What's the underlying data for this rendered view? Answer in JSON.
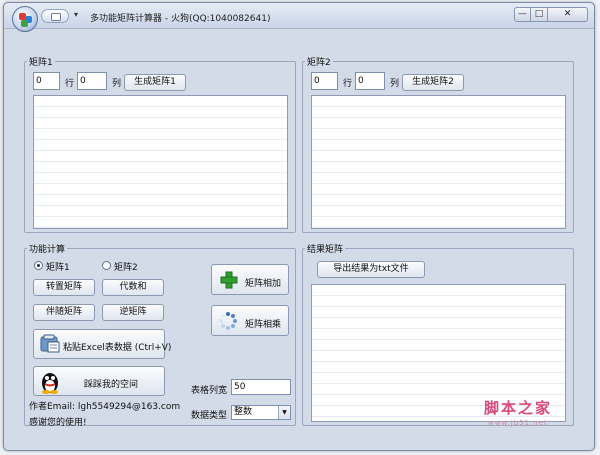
{
  "window": {
    "title": "多功能矩阵计算器 - 火狗(QQ:1040082641)",
    "controls": {
      "minimize": "—",
      "maximize": "□",
      "close": "✕"
    }
  },
  "matrix1": {
    "group_label": "矩阵1",
    "rows_value": "0",
    "rows_label": "行",
    "cols_value": "0",
    "cols_label": "列",
    "generate_label": "生成矩阵1"
  },
  "matrix2": {
    "group_label": "矩阵2",
    "rows_value": "0",
    "rows_label": "行",
    "cols_value": "0",
    "cols_label": "列",
    "generate_label": "生成矩阵2"
  },
  "functions": {
    "group_label": "功能计算",
    "radio1_label": "矩阵1",
    "radio2_label": "矩阵2",
    "selected": "矩阵1",
    "transpose_label": "转置矩阵",
    "cofactor_label": "代数和",
    "adjugate_label": "伴随矩阵",
    "inverse_label": "逆矩阵",
    "add_label": "矩阵相加",
    "multiply_label": "矩阵相乘",
    "paste_excel_label": "粘贴Excel表数据 (Ctrl+V)",
    "qq_label": "踩踩我的空间",
    "col_width_label": "表格列宽",
    "col_width_value": "50",
    "data_type_label": "数据类型",
    "data_type_value": "整数",
    "author_email": "作者Email: lgh5549294@163.com",
    "thanks": "感谢您的使用!"
  },
  "result": {
    "group_label": "结果矩阵",
    "export_label": "导出结果为txt文件"
  },
  "watermark": {
    "title": "脚本之家",
    "url": "www.jb51.net"
  },
  "colors": {
    "window_bg": "#d3dbe9",
    "accent_pink": "#d94a7b",
    "plus_green": "#2fa12f"
  }
}
